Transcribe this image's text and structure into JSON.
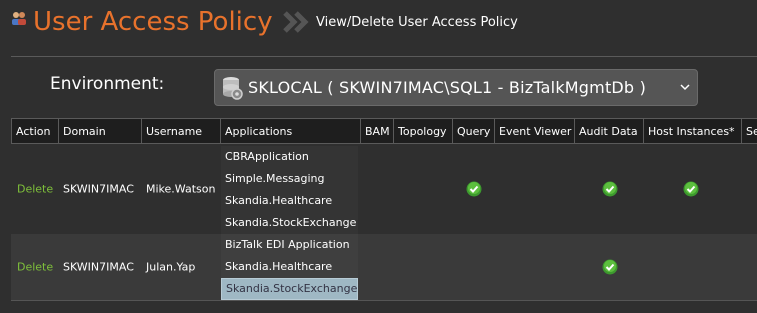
{
  "header": {
    "title": "User Access Policy",
    "subtitle": "View/Delete User Access Policy"
  },
  "environment": {
    "label": "Environment:",
    "selected": "SKLOCAL  ( SKWIN7IMAC\\SQL1 - BizTalkMgmtDb )"
  },
  "table": {
    "columns": [
      "Action",
      "Domain",
      "Username",
      "Applications",
      "BAM",
      "Topology",
      "Query",
      "Event Viewer",
      "Audit Data",
      "Host Instances*",
      "Se"
    ],
    "rows": [
      {
        "action": "Delete",
        "domain": "SKWIN7IMAC",
        "username": "Mike.Watson",
        "applications": [
          "CBRApplication",
          "Simple.Messaging",
          "Skandia.Healthcare",
          "Skandia.StockExchange"
        ],
        "permissions": {
          "bam": false,
          "topology": false,
          "query": true,
          "event_viewer": false,
          "audit_data": true,
          "host_instances": true
        }
      },
      {
        "action": "Delete",
        "domain": "SKWIN7IMAC",
        "username": "Julan.Yap",
        "applications": [
          "BizTalk EDI Application",
          "Skandia.Healthcare",
          "Skandia.StockExchange"
        ],
        "selected_application": "Skandia.StockExchange",
        "permissions": {
          "bam": false,
          "topology": false,
          "query": false,
          "event_viewer": false,
          "audit_data": true,
          "host_instances": false
        }
      }
    ]
  },
  "colors": {
    "title": "#e8722c",
    "delete_link": "#7fc13a",
    "check": "#4caf50",
    "background": "#2f2f2f"
  },
  "icons": {
    "header": "users-icon",
    "breadcrumb": "double-chevron-icon",
    "database": "database-icon",
    "dropdown": "chevron-down-icon",
    "permission": "checkmark-icon"
  }
}
